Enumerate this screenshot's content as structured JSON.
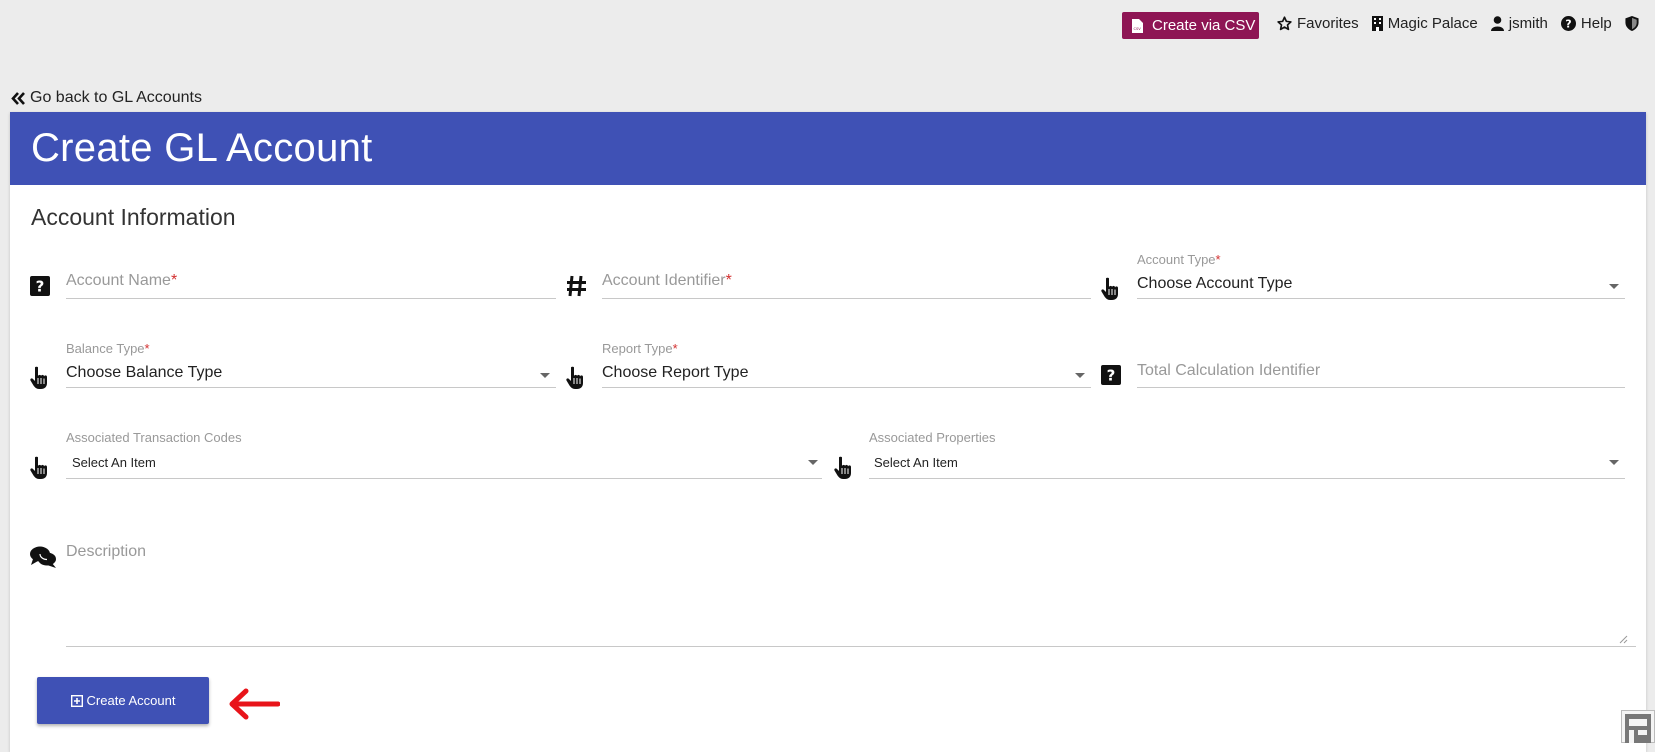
{
  "topbar": {
    "csv_button": "Create via CSV",
    "favorites": "Favorites",
    "property": "Magic Palace",
    "user": "jsmith",
    "help": "Help"
  },
  "back_link": "Go back to GL Accounts",
  "card": {
    "title": "Create GL Account",
    "section_title": "Account Information"
  },
  "form": {
    "account_name": {
      "placeholder": "Account Name",
      "required": "*"
    },
    "account_identifier": {
      "placeholder": "Account Identifier",
      "required": "*"
    },
    "account_type": {
      "label": "Account Type",
      "required": "*",
      "value": "Choose Account Type"
    },
    "balance_type": {
      "label": "Balance Type",
      "required": "*",
      "value": "Choose Balance Type"
    },
    "report_type": {
      "label": "Report Type",
      "required": "*",
      "value": "Choose Report Type"
    },
    "total_calc": {
      "placeholder": "Total Calculation Identifier"
    },
    "transaction_codes": {
      "label": "Associated Transaction Codes",
      "value": "Select An Item"
    },
    "properties": {
      "label": "Associated Properties",
      "value": "Select An Item"
    },
    "description": {
      "placeholder": "Description"
    }
  },
  "create_button": "Create Account",
  "colors": {
    "header_blue": "#3f51b5",
    "csv_button": "#8e1554",
    "required": "#d32f2f",
    "arrow": "#e8141a"
  }
}
